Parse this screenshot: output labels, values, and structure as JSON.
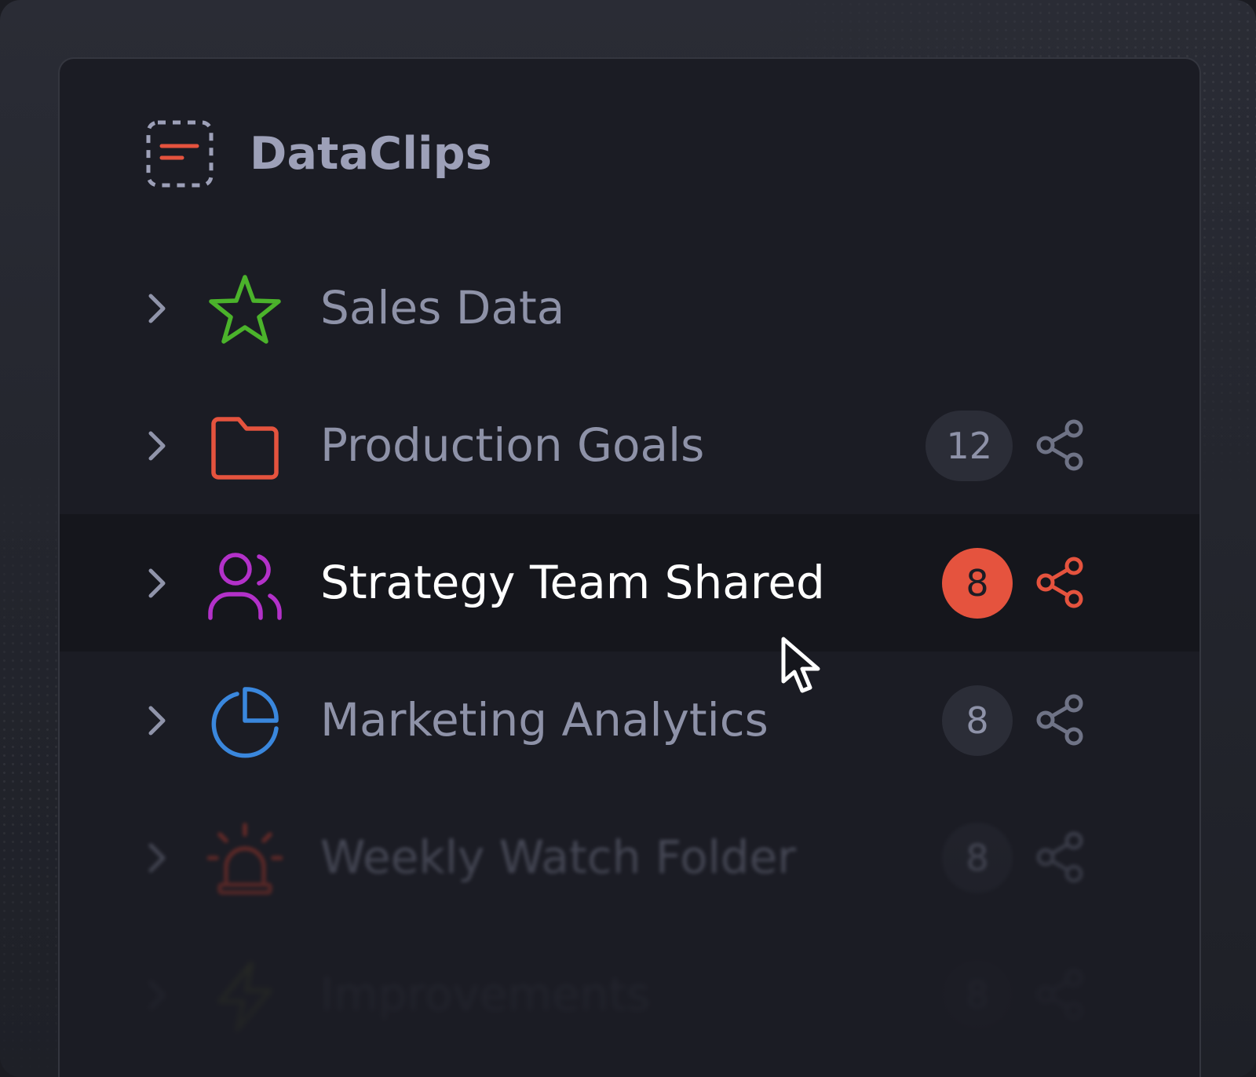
{
  "app": {
    "name": "DataClips",
    "logo_icon": "dashed-box-lines-icon"
  },
  "colors": {
    "accent": "#e5533e",
    "panel_bg": "#1b1c24",
    "active_row_bg": "#15161c",
    "muted_text": "#8e92a8",
    "badge_bg": "#2b2d37"
  },
  "sidebar": {
    "items": [
      {
        "label": "Sales Data",
        "icon": "star-icon",
        "icon_color": "#4bb32b",
        "count": null,
        "shared": false,
        "active": false
      },
      {
        "label": "Production Goals",
        "icon": "folder-icon",
        "icon_color": "#e5533e",
        "count": "12",
        "shared": true,
        "active": false
      },
      {
        "label": "Strategy Team Shared",
        "icon": "users-icon",
        "icon_color": "#b331c9",
        "count": "8",
        "shared": true,
        "active": true
      },
      {
        "label": "Marketing Analytics",
        "icon": "pie-chart-icon",
        "icon_color": "#3a87dd",
        "count": "8",
        "shared": true,
        "active": false
      },
      {
        "label": "Weekly Watch Folder",
        "icon": "alarm-light-icon",
        "icon_color": "#d6402c",
        "count": "8",
        "shared": true,
        "active": false
      },
      {
        "label": "Improvements",
        "icon": "lightning-icon",
        "icon_color": "#a5b61f",
        "count": "8",
        "shared": true,
        "active": false
      }
    ]
  }
}
